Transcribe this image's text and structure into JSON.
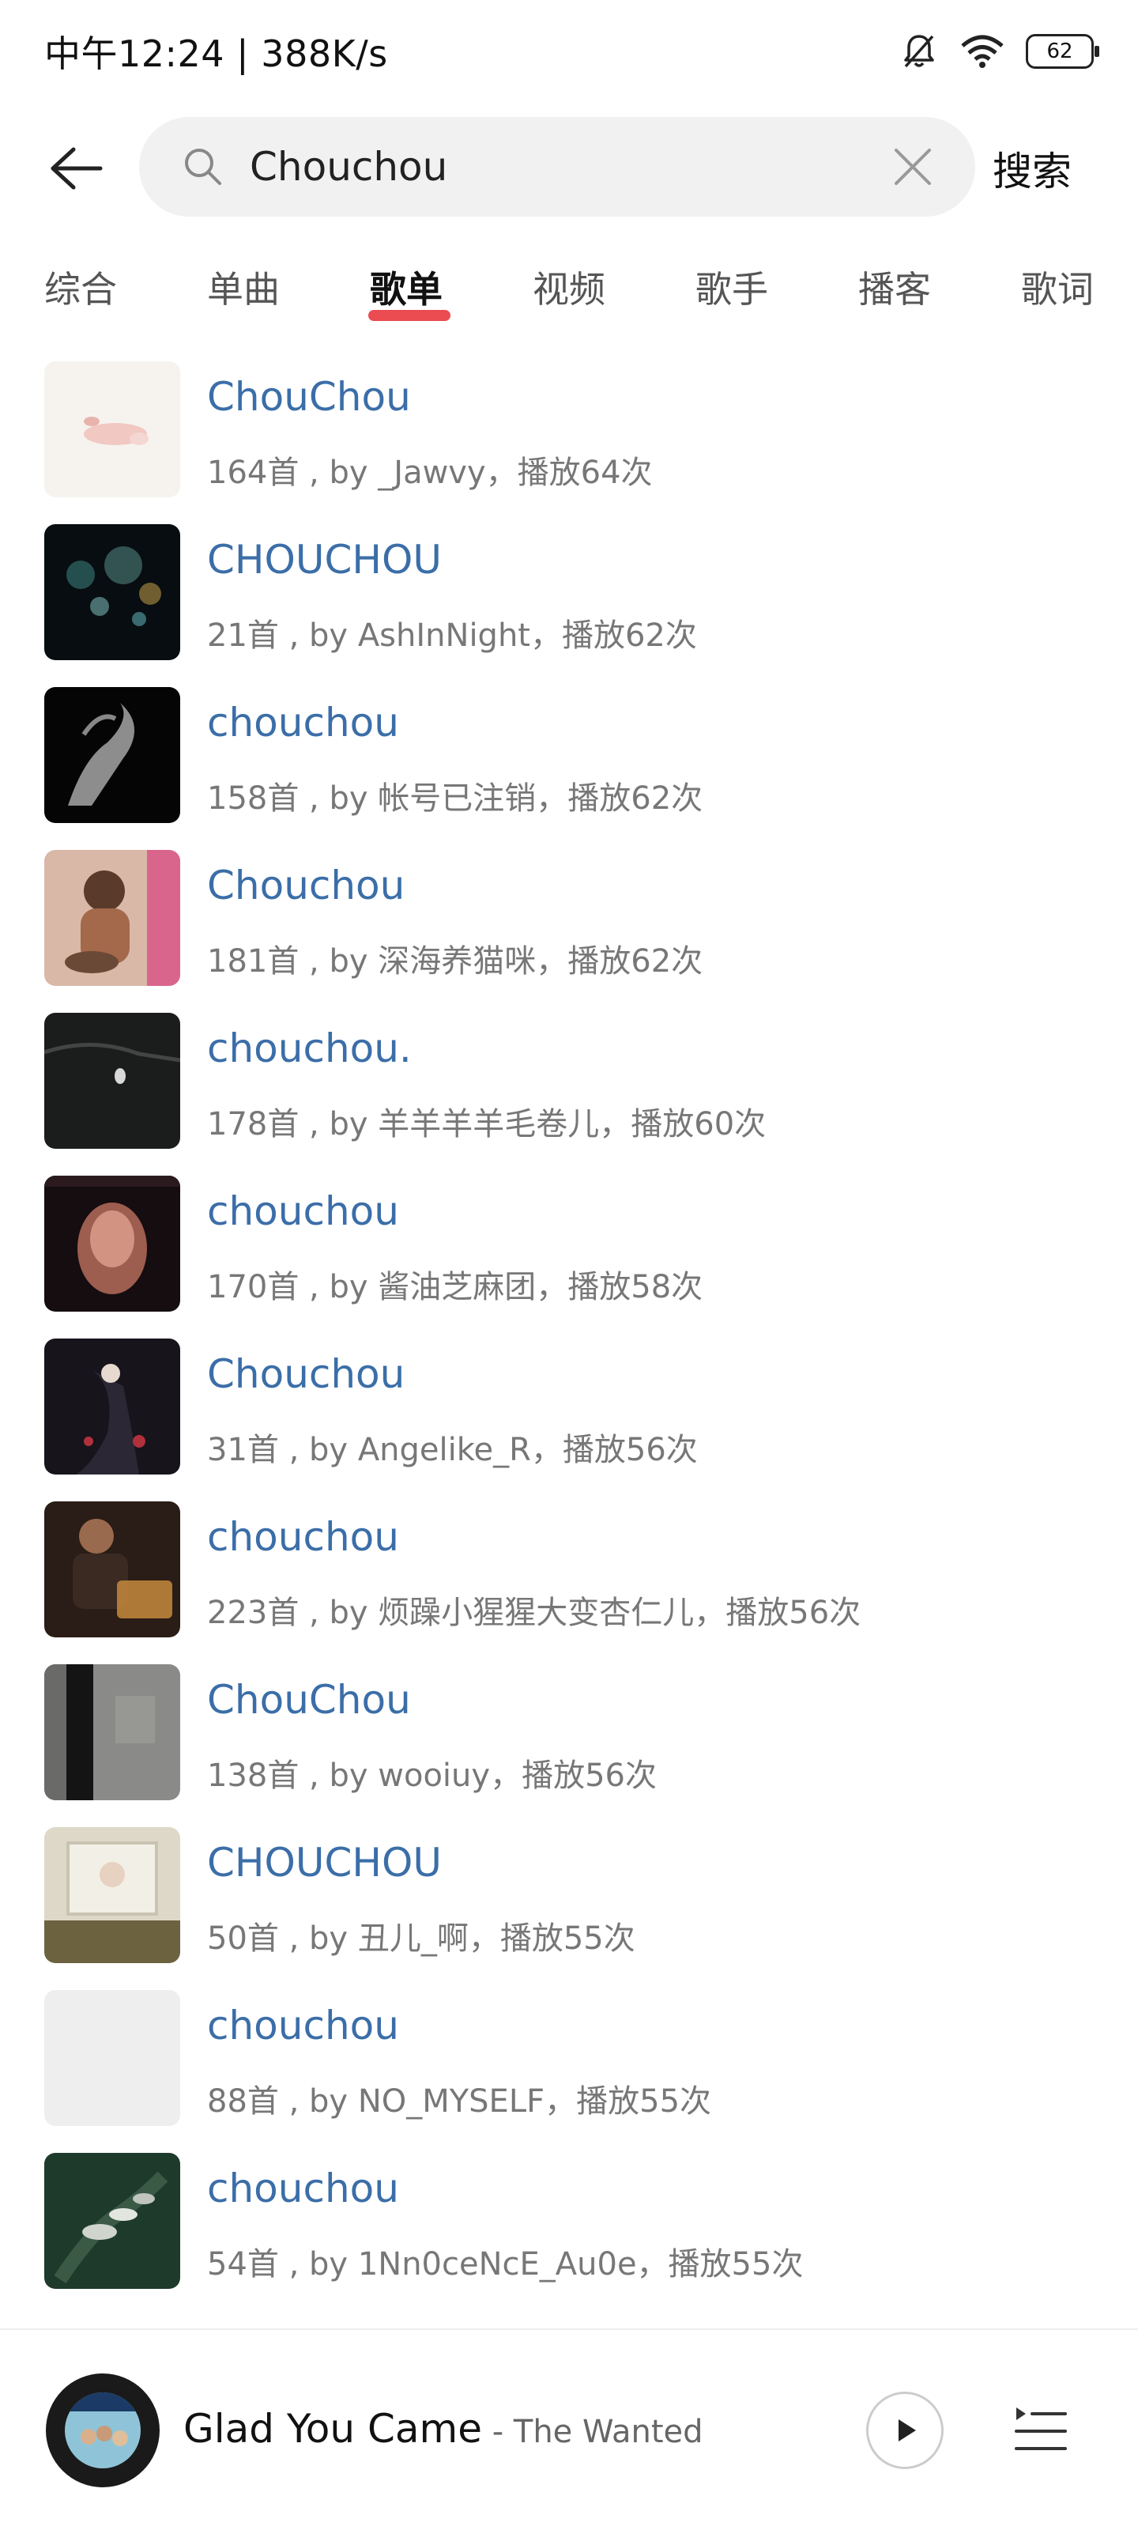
{
  "status_bar": {
    "time_speed": "中午12:24 | 388K/s",
    "battery": "62"
  },
  "search": {
    "query": "Chouchou",
    "submit_label": "搜索"
  },
  "tabs": [
    {
      "label": "综合"
    },
    {
      "label": "单曲"
    },
    {
      "label": "歌单"
    },
    {
      "label": "视频"
    },
    {
      "label": "歌手"
    },
    {
      "label": "播客"
    },
    {
      "label": "歌词"
    }
  ],
  "active_tab": "歌单",
  "playlists": [
    {
      "title": "ChouChou",
      "subtitle": "164首 , by _Jawvy，播放64次"
    },
    {
      "title": "CHOUCHOU",
      "subtitle": "21首 , by AshInNight，播放62次"
    },
    {
      "title": "chouchou",
      "subtitle": "158首 , by 帐号已注销，播放62次"
    },
    {
      "title": "Chouchou",
      "subtitle": "181首 , by 深海养猫咪，播放62次"
    },
    {
      "title": "chouchou.",
      "subtitle": "178首 , by 羊羊羊羊毛卷儿，播放60次"
    },
    {
      "title": "chouchou",
      "subtitle": "170首 , by 酱油芝麻团，播放58次"
    },
    {
      "title": "Chouchou",
      "subtitle": "31首 , by Angelike_R，播放56次"
    },
    {
      "title": "chouchou",
      "subtitle": "223首 , by 烦躁小猩猩大变杏仁儿，播放56次"
    },
    {
      "title": "ChouChou",
      "subtitle": "138首 , by wooiuy，播放56次"
    },
    {
      "title": "CHOUCHOU",
      "subtitle": "50首 , by 丑儿_啊，播放55次"
    },
    {
      "title": "chouchou",
      "subtitle": "88首 , by NO_MYSELF，播放55次"
    },
    {
      "title": "chouchou",
      "subtitle": "54首 , by 1Nn0ceNcE_Au0e，播放55次"
    }
  ],
  "player": {
    "song": "Glad You Came",
    "separator": " - ",
    "artist": "The Wanted"
  }
}
